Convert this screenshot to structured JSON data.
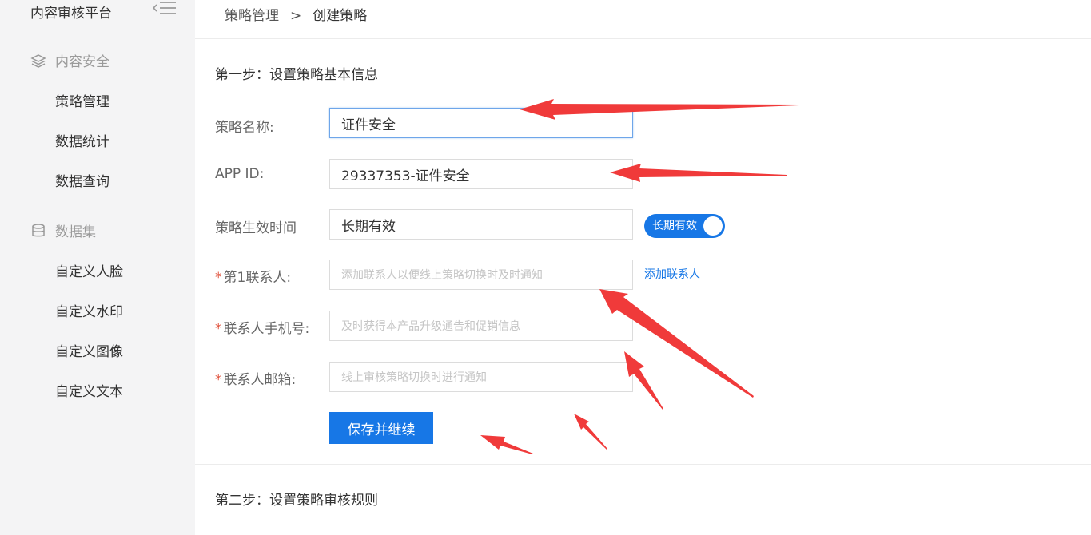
{
  "sidebar": {
    "brand": "内容审核平台",
    "sections": [
      {
        "title": "内容安全",
        "icon": "layers-icon",
        "items": [
          "策略管理",
          "数据统计",
          "数据查询"
        ]
      },
      {
        "title": "数据集",
        "icon": "database-icon",
        "items": [
          "自定义人脸",
          "自定义水印",
          "自定义图像",
          "自定义文本"
        ]
      }
    ]
  },
  "breadcrumb": {
    "parent": "策略管理",
    "separator": ">",
    "current": "创建策略"
  },
  "step1": {
    "title": "第一步：设置策略基本信息",
    "name_label": "策略名称:",
    "name_value": "证件安全",
    "appid_label": "APP ID:",
    "appid_value": "29337353-证件安全",
    "time_label": "策略生效时间",
    "time_value": "长期有效",
    "toggle_label": "长期有效",
    "contact_required": "*",
    "contact_label": "第1联系人:",
    "contact_placeholder": "添加联系人以便线上策略切换时及时通知",
    "add_contact": "添加联系人",
    "phone_required": "*",
    "phone_label": "联系人手机号:",
    "phone_placeholder": "及时获得本产品升级通告和促销信息",
    "email_required": "*",
    "email_label": "联系人邮箱:",
    "email_placeholder": "线上审核策略切换时进行通知",
    "save_button": "保存并继续"
  },
  "step2": {
    "title": "第二步：设置策略审核规则"
  },
  "colors": {
    "accent": "#1777e6",
    "annotation": "#f03a3a",
    "required": "#e0533e"
  }
}
